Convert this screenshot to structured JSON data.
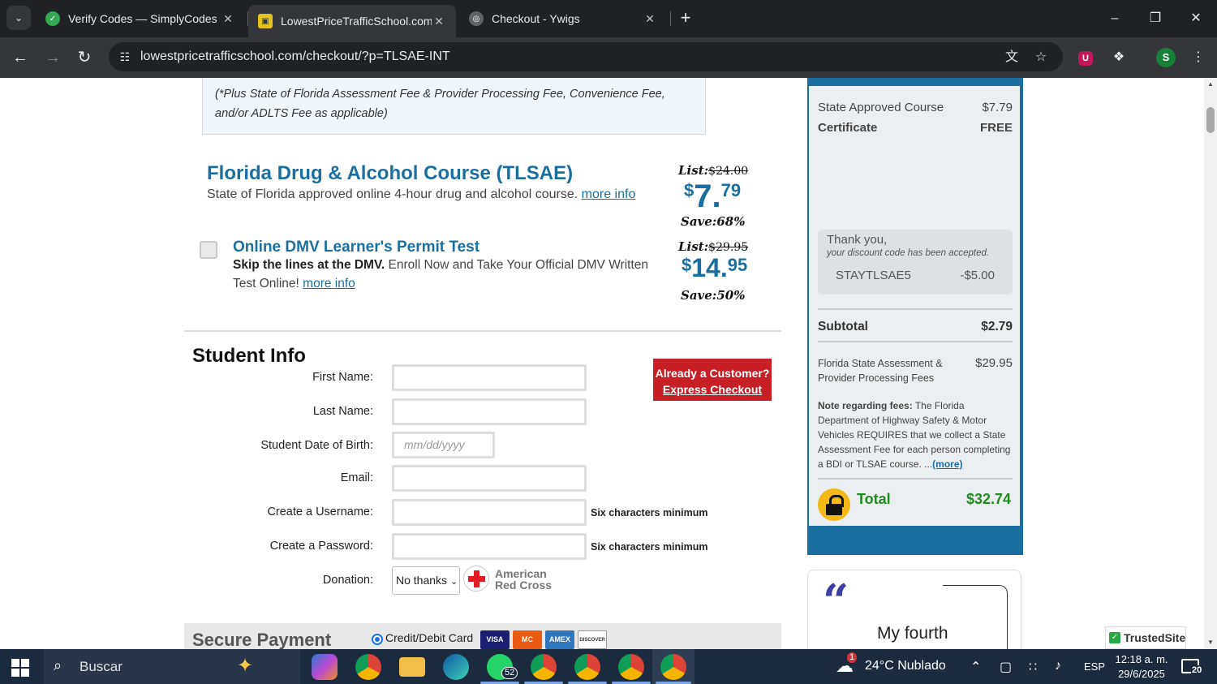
{
  "browser": {
    "tabs": [
      {
        "title": "Verify Codes — SimplyCodes"
      },
      {
        "title": "LowestPriceTrafficSchool.com"
      },
      {
        "title": "Checkout - Ywigs"
      }
    ],
    "url": "lowestpricetrafficschool.com/checkout/?p=TLSAE-INT",
    "profile_initial": "S"
  },
  "page": {
    "fee_note": "(*Plus State of Florida Assessment Fee & Provider Processing Fee, Convenience Fee, and/or ADLTS Fee as applicable)",
    "course1": {
      "title": "Florida Drug & Alcohol Course (TLSAE)",
      "desc": "State of Florida approved online 4-hour drug and alcohol course.",
      "more": "more info",
      "list_label": "List:",
      "list_price": "$24.00",
      "currency": "$",
      "dollars": "7.",
      "cents": "79",
      "save": "Save:68%"
    },
    "course2": {
      "title": "Online DMV Learner's Permit Test",
      "desc_bold": "Skip the lines at the DMV.",
      "desc": "Enroll Now and Take Your Official DMV Written Test Online!",
      "more": "more info",
      "list_label": "List:",
      "list_price": "$29.95",
      "currency": "$",
      "dollars": "14.",
      "cents": "95",
      "save": "Save:50%"
    },
    "student_info": {
      "heading": "Student Info",
      "first_name": "First Name:",
      "last_name": "Last Name:",
      "dob": "Student Date of Birth:",
      "dob_placeholder": "mm/dd/yyyy",
      "email": "Email:",
      "username": "Create a Username:",
      "password": "Create a Password:",
      "min_hint": "Six characters minimum",
      "donation": "Donation:",
      "donation_value": "No thanks",
      "red_cross_line1": "American",
      "red_cross_line2": "Red Cross"
    },
    "express": {
      "line1": "Already a Customer?",
      "line2": "Express Checkout"
    },
    "payment": {
      "heading": "Secure Payment",
      "option": "Credit/Debit Card",
      "cards": [
        "VISA",
        "MC",
        "AMEX",
        "DISCOVER"
      ]
    }
  },
  "sidebar": {
    "course_label": "State Approved Course",
    "course_price": "$7.79",
    "cert_label": "Certificate",
    "cert_price": "FREE",
    "thanks": "Thank you,",
    "thanks_sub": "your discount code has been accepted.",
    "code": "STAYTLSAE5",
    "code_amount": "-$5.00",
    "subtotal_label": "Subtotal",
    "subtotal": "$2.79",
    "fee_label": "Florida State Assessment & Provider Processing Fees",
    "fee_amount": "$29.95",
    "note_bold": "Note regarding fees:",
    "note": "The Florida Department of Highway Safety & Motor Vehicles REQUIRES that we collect a State Assessment Fee for each person completing a BDI or TLSAE course. ...",
    "note_more": "(more)",
    "total_label": "Total",
    "total": "$32.74"
  },
  "testimonial": {
    "text": "My fourth"
  },
  "trusted": "TrustedSite",
  "taskbar": {
    "search": "Buscar",
    "whatsapp_badge": "52",
    "weather": "24°C  Nublado",
    "lang": "ESP",
    "time": "12:18 a. m.",
    "date": "29/6/2025",
    "notifications": "20",
    "weather_badge": "1"
  },
  "colors": {
    "brand_blue": "#1a6fa0",
    "express_red": "#c62025",
    "total_green": "#1e8c1e"
  }
}
